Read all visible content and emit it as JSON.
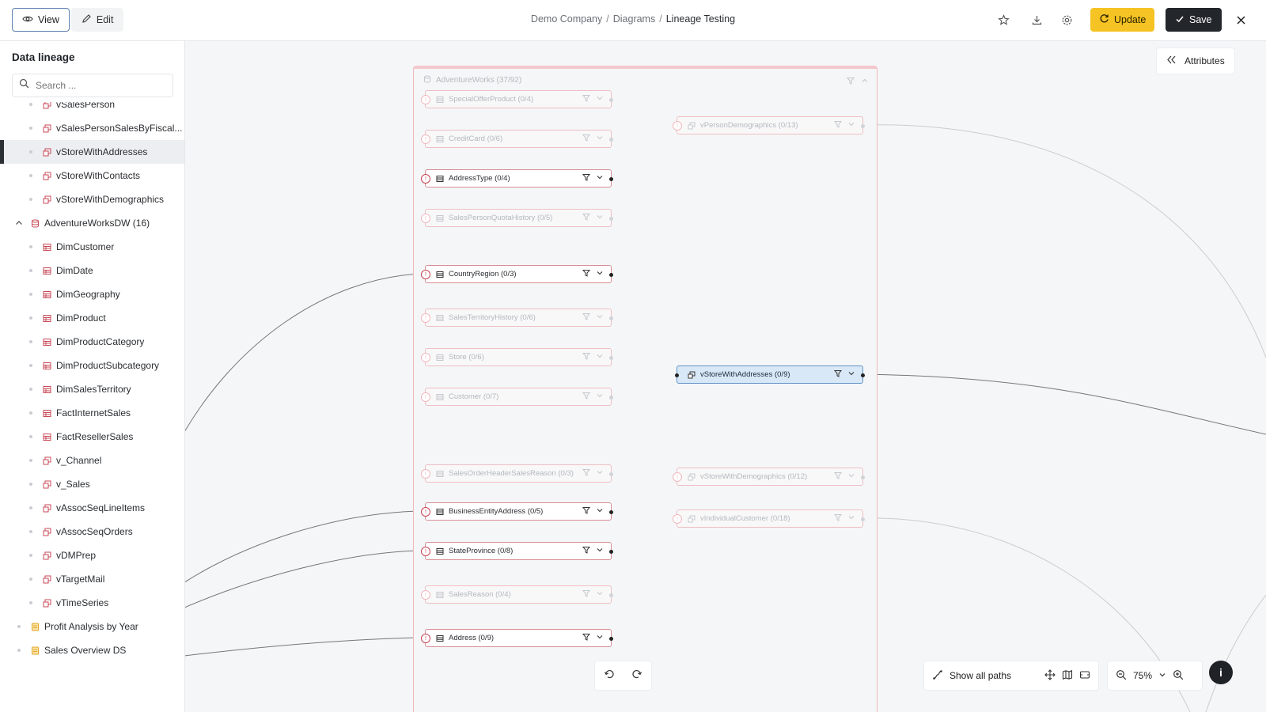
{
  "header": {
    "view_label": "View",
    "edit_label": "Edit",
    "breadcrumb": [
      "Demo Company",
      "Diagrams",
      "Lineage Testing"
    ],
    "update_label": "Update",
    "save_label": "Save",
    "accent_color": "#f6c324"
  },
  "sidebar": {
    "title": "Data lineage",
    "search_placeholder": "Search ...",
    "items": [
      {
        "label": "vSalesPerson",
        "icon": "view-icon",
        "level": 2
      },
      {
        "label": "vSalesPersonSalesByFiscal...",
        "icon": "view-icon",
        "level": 2
      },
      {
        "label": "vStoreWithAddresses",
        "icon": "view-icon",
        "level": 2,
        "selected": true
      },
      {
        "label": "vStoreWithContacts",
        "icon": "view-icon",
        "level": 2
      },
      {
        "label": "vStoreWithDemographics",
        "icon": "view-icon",
        "level": 2
      },
      {
        "label": "AdventureWorksDW (16)",
        "icon": "database-icon",
        "level": 1,
        "expanded": true
      },
      {
        "label": "DimCustomer",
        "icon": "table-icon",
        "level": 2
      },
      {
        "label": "DimDate",
        "icon": "table-icon",
        "level": 2
      },
      {
        "label": "DimGeography",
        "icon": "table-icon",
        "level": 2
      },
      {
        "label": "DimProduct",
        "icon": "table-icon",
        "level": 2
      },
      {
        "label": "DimProductCategory",
        "icon": "table-icon",
        "level": 2
      },
      {
        "label": "DimProductSubcategory",
        "icon": "table-icon",
        "level": 2
      },
      {
        "label": "DimSalesTerritory",
        "icon": "table-icon",
        "level": 2
      },
      {
        "label": "FactInternetSales",
        "icon": "table-icon",
        "level": 2
      },
      {
        "label": "FactResellerSales",
        "icon": "table-icon",
        "level": 2
      },
      {
        "label": "v_Channel",
        "icon": "view-icon",
        "level": 2
      },
      {
        "label": "v_Sales",
        "icon": "view-icon",
        "level": 2
      },
      {
        "label": "vAssocSeqLineItems",
        "icon": "view-icon",
        "level": 2
      },
      {
        "label": "vAssocSeqOrders",
        "icon": "view-icon",
        "level": 2
      },
      {
        "label": "vDMPrep",
        "icon": "view-icon",
        "level": 2
      },
      {
        "label": "vTargetMail",
        "icon": "view-icon",
        "level": 2
      },
      {
        "label": "vTimeSeries",
        "icon": "view-icon",
        "level": 2
      },
      {
        "label": "Profit Analysis by Year",
        "icon": "dataset-icon",
        "level": 1
      },
      {
        "label": "Sales Overview DS",
        "icon": "dataset-icon",
        "level": 1
      }
    ]
  },
  "canvas": {
    "group_title": "AdventureWorks (37/92)",
    "attributes_label": "Attributes",
    "show_paths_label": "Show all paths",
    "zoom": "75%",
    "nodes": [
      {
        "label": "SpecialOfferProduct (0/4)",
        "state": "dim"
      },
      {
        "label": "CreditCard (0/6)",
        "state": "dim"
      },
      {
        "label": "AddressType (0/4)",
        "state": "active"
      },
      {
        "label": "SalesPersonQuotaHistory (0/5)",
        "state": "dim"
      },
      {
        "label": "CountryRegion (0/3)",
        "state": "active"
      },
      {
        "label": "SalesTerritoryHistory (0/6)",
        "state": "dim"
      },
      {
        "label": "Store (0/6)",
        "state": "dim"
      },
      {
        "label": "Customer (0/7)",
        "state": "dim"
      },
      {
        "label": "SalesOrderHeaderSalesReason (0/3)",
        "state": "dim"
      },
      {
        "label": "BusinessEntityAddress (0/5)",
        "state": "active"
      },
      {
        "label": "StateProvince (0/8)",
        "state": "active"
      },
      {
        "label": "SalesReason (0/4)",
        "state": "dim"
      },
      {
        "label": "Address (0/9)",
        "state": "active"
      },
      {
        "label": "vPersonDemographics (0/13)",
        "state": "dim"
      },
      {
        "label": "vStoreWithAddresses (0/9)",
        "state": "highlighted"
      },
      {
        "label": "vStoreWithDemographics (0/12)",
        "state": "dim"
      },
      {
        "label": "vIndividualCustomer (0/18)",
        "state": "dim"
      }
    ]
  }
}
